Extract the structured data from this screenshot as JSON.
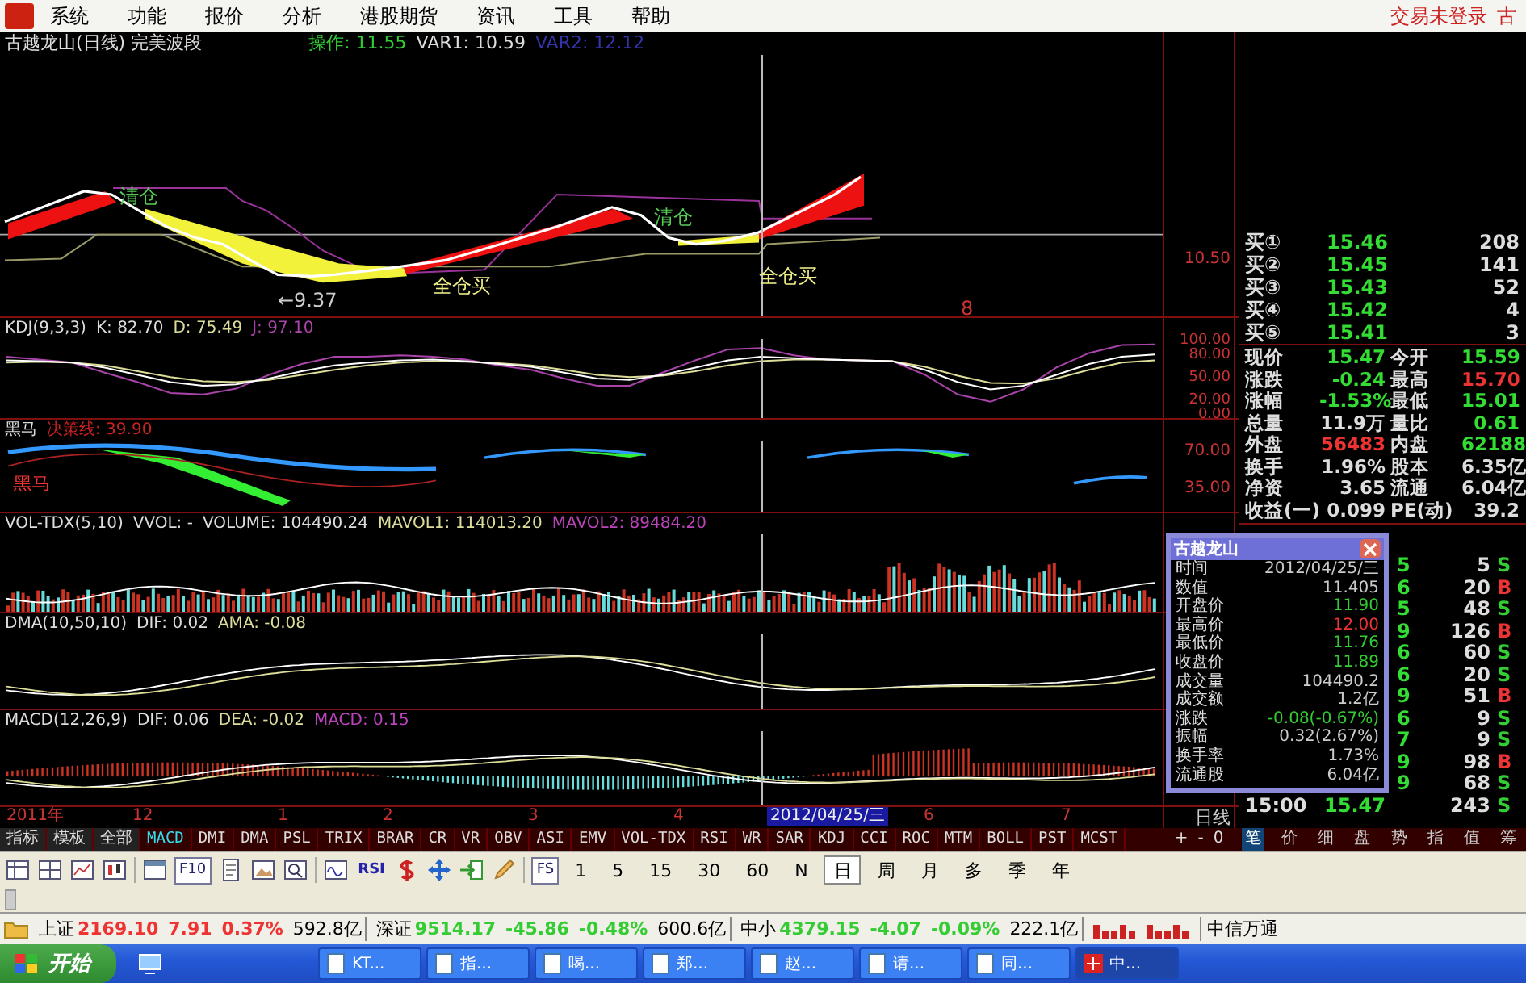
{
  "menu_bar": {
    "items": [
      "系统",
      "功能",
      "报价",
      "分析",
      "港股期货",
      "资讯",
      "工具",
      "帮助"
    ],
    "right_texts": [
      "交易未登录",
      "古"
    ]
  },
  "price_panel": {
    "title": "古越龙山(日线) 完美波段",
    "readouts": [
      {
        "text": "操作: 11.55",
        "color": "#33cc33"
      },
      {
        "text": "VAR1: 10.59",
        "color": "#dddddd"
      },
      {
        "text": "VAR2: 12.12",
        "color": "#3333aa"
      }
    ],
    "chart_labels": [
      {
        "text": "清仓",
        "kind": "sell"
      },
      {
        "text": "全仓买",
        "kind": "buy"
      },
      {
        "text": "清仓",
        "kind": "sell"
      },
      {
        "text": "全仓买",
        "kind": "buy"
      },
      {
        "text": "←9.37",
        "kind": "low"
      },
      {
        "text": "8",
        "kind": "marker"
      }
    ],
    "axis_labels": [
      "10.50"
    ]
  },
  "indicator_panels": [
    {
      "kind": "kdj",
      "readouts": [
        {
          "text": "KDJ(9,3,3)",
          "color": "#dddddd"
        },
        {
          "text": "K: 82.70",
          "color": "#dddddd"
        },
        {
          "text": "D: 75.49",
          "color": "#dddd99"
        },
        {
          "text": "J: 97.10",
          "color": "#aa44aa"
        }
      ],
      "chart_data": {
        "type": "line",
        "ylim": [
          0,
          100
        ],
        "yticks": [
          {
            "value": 100,
            "label": "100.00"
          },
          {
            "value": 80,
            "label": "80.00"
          },
          {
            "value": 50,
            "label": "50.00"
          },
          {
            "value": 20,
            "label": "20.00"
          },
          {
            "value": 0,
            "label": "0.00"
          }
        ],
        "series": [
          {
            "color": "#aa44aa",
            "values": [
              80,
              76,
              72,
              58,
              45,
              30,
              28,
              36,
              55,
              70,
              80,
              80,
              82,
              80,
              76,
              68,
              62,
              50,
              40,
              40,
              58,
              75,
              90,
              92,
              82,
              76,
              75,
              74,
              55,
              28,
              18,
              35,
              65,
              85,
              96,
              97
            ]
          },
          {
            "color": "#dddd99",
            "values": [
              72,
              73,
              72,
              68,
              60,
              52,
              46,
              45,
              48,
              55,
              62,
              68,
              72,
              74,
              73,
              71,
              68,
              62,
              55,
              52,
              54,
              60,
              68,
              74,
              76,
              76,
              75,
              74,
              66,
              54,
              44,
              43,
              50,
              62,
              72,
              75
            ]
          },
          {
            "color": "#ffffff",
            "values": [
              75,
              74,
              72,
              65,
              55,
              45,
              40,
              42,
              50,
              60,
              68,
              72,
              75,
              76,
              74,
              70,
              66,
              58,
              50,
              48,
              55,
              65,
              75,
              80,
              78,
              76,
              75,
              74,
              62,
              45,
              35,
              40,
              55,
              70,
              80,
              83
            ]
          }
        ]
      }
    },
    {
      "kind": "heima",
      "readouts": [
        {
          "text": "黑马",
          "color": "#dddddd"
        },
        {
          "text": "决策线: 39.90",
          "color": "#cc2222"
        }
      ],
      "chart_label": "黑马",
      "axis_labels": [
        "70.00",
        "35.00"
      ]
    },
    {
      "kind": "volume",
      "readouts": [
        {
          "text": "VOL-TDX(5,10)",
          "color": "#dddddd"
        },
        {
          "text": "VVOL: -",
          "color": "#dddddd"
        },
        {
          "text": "VOLUME: 104490.24",
          "color": "#dddddd"
        },
        {
          "text": "MAVOL1: 114013.20",
          "color": "#dddd99"
        },
        {
          "text": "MAVOL2: 89484.20",
          "color": "#bb44bb"
        }
      ]
    },
    {
      "kind": "dma",
      "readouts": [
        {
          "text": "DMA(10,50,10)",
          "color": "#dddddd"
        },
        {
          "text": "DIF: 0.02",
          "color": "#dddddd"
        },
        {
          "text": "AMA: -0.08",
          "color": "#dddd99"
        }
      ]
    },
    {
      "kind": "macd",
      "readouts": [
        {
          "text": "MACD(12,26,9)",
          "color": "#dddddd"
        },
        {
          "text": "DIF: 0.06",
          "color": "#dddddd"
        },
        {
          "text": "DEA: -0.02",
          "color": "#dddd99"
        },
        {
          "text": "MACD: 0.15",
          "color": "#bb44bb"
        }
      ]
    }
  ],
  "date_axis": {
    "labels": [
      {
        "text": "2011年",
        "selected": false
      },
      {
        "text": "12",
        "selected": false
      },
      {
        "text": "1",
        "selected": false
      },
      {
        "text": "2",
        "selected": false
      },
      {
        "text": "3",
        "selected": false
      },
      {
        "text": "4",
        "selected": false
      },
      {
        "text": "2012/04/25/三",
        "selected": true
      },
      {
        "text": "6",
        "selected": false
      },
      {
        "text": "7",
        "selected": false
      }
    ],
    "period_label": "日线"
  },
  "order_book": [
    {
      "label": "买①",
      "price": "15.46",
      "volume": "208"
    },
    {
      "label": "买②",
      "price": "15.45",
      "volume": "141"
    },
    {
      "label": "买③",
      "price": "15.43",
      "volume": "52"
    },
    {
      "label": "买④",
      "price": "15.42",
      "volume": "4"
    },
    {
      "label": "买⑤",
      "price": "15.41",
      "volume": "3"
    }
  ],
  "stats": [
    {
      "cells": [
        {
          "text": "现价"
        },
        {
          "text": "15.47",
          "color": "#33dd33"
        },
        {
          "text": "今开"
        },
        {
          "text": "15.59",
          "color": "#33dd33"
        }
      ]
    },
    {
      "cells": [
        {
          "text": "涨跌"
        },
        {
          "text": "-0.24",
          "color": "#33dd33"
        },
        {
          "text": "最高"
        },
        {
          "text": "15.70",
          "color": "#ee3333"
        }
      ]
    },
    {
      "cells": [
        {
          "text": "涨幅"
        },
        {
          "text": "-1.53%",
          "color": "#33dd33"
        },
        {
          "text": "最低"
        },
        {
          "text": "15.01",
          "color": "#33dd33"
        }
      ]
    },
    {
      "cells": [
        {
          "text": "总量"
        },
        {
          "text": "11.9万",
          "color": "#dddddd"
        },
        {
          "text": "量比"
        },
        {
          "text": "0.61",
          "color": "#33dd33"
        }
      ]
    },
    {
      "cells": [
        {
          "text": "外盘"
        },
        {
          "text": "56483",
          "color": "#ee3333"
        },
        {
          "text": "内盘"
        },
        {
          "text": "62188",
          "color": "#33dd33"
        }
      ]
    },
    {
      "cells": [
        {
          "text": "换手"
        },
        {
          "text": "1.96%",
          "color": "#dddddd"
        },
        {
          "text": "股本"
        },
        {
          "text": "6.35亿",
          "color": "#dddddd"
        }
      ]
    },
    {
      "cells": [
        {
          "text": "净资"
        },
        {
          "text": "3.65",
          "color": "#dddddd"
        },
        {
          "text": "流通"
        },
        {
          "text": "6.04亿",
          "color": "#dddddd"
        }
      ]
    },
    {
      "cells": [
        {
          "text": "收益(一)"
        },
        {
          "text": "0.099",
          "color": "#dddddd"
        },
        {
          "text": "PE(动)"
        },
        {
          "text": "39.2",
          "color": "#dddddd"
        }
      ]
    }
  ],
  "ticks": [
    {
      "price": "5",
      "volume": "5",
      "side": "S",
      "kind": "sell"
    },
    {
      "price": "6",
      "volume": "20",
      "side": "B",
      "kind": "buy"
    },
    {
      "price": "5",
      "volume": "48",
      "side": "S",
      "kind": "sell"
    },
    {
      "price": "9",
      "volume": "126",
      "side": "B",
      "kind": "buy"
    },
    {
      "price": "6",
      "volume": "60",
      "side": "S",
      "kind": "sell"
    },
    {
      "price": "6",
      "volume": "20",
      "side": "S",
      "kind": "sell"
    },
    {
      "price": "9",
      "volume": "51",
      "side": "B",
      "kind": "buy"
    },
    {
      "price": "6",
      "volume": "9",
      "side": "S",
      "kind": "sell"
    },
    {
      "price": "7",
      "volume": "9",
      "side": "S",
      "kind": "sell"
    },
    {
      "price": "9",
      "volume": "98",
      "side": "B",
      "kind": "buy"
    },
    {
      "price": "9",
      "volume": "68",
      "side": "S",
      "kind": "sell"
    },
    {
      "time": "15:00",
      "price": "15.47",
      "volume": "243",
      "side": "S",
      "kind": "sell"
    }
  ],
  "popup": {
    "title": "古越龙山",
    "rows": [
      {
        "label": "时间",
        "value": "2012/04/25/三"
      },
      {
        "label": "数值",
        "value": "11.405"
      },
      {
        "label": "开盘价",
        "value": "11.90",
        "color": "#33cc33"
      },
      {
        "label": "最高价",
        "value": "12.00",
        "color": "#ee3333"
      },
      {
        "label": "最低价",
        "value": "11.76",
        "color": "#33cc33"
      },
      {
        "label": "收盘价",
        "value": "11.89",
        "color": "#33cc33"
      },
      {
        "label": "成交量",
        "value": "104490.2"
      },
      {
        "label": "成交额",
        "value": "1.2亿"
      },
      {
        "label": "涨跌",
        "value": "-0.08(-0.67%)",
        "color": "#33cc33"
      },
      {
        "label": "振幅",
        "value": "0.32(2.67%)"
      },
      {
        "label": "换手率",
        "value": "1.73%"
      },
      {
        "label": "流通股",
        "value": "6.04亿"
      }
    ]
  },
  "indicator_tabs": [
    {
      "label": "指标",
      "selected": false
    },
    {
      "label": "模板",
      "selected": false
    },
    {
      "label": "全部",
      "selected": false
    },
    {
      "label": "MACD",
      "selected": true
    },
    {
      "label": "DMI",
      "selected": false
    },
    {
      "label": "DMA",
      "selected": false
    },
    {
      "label": "PSL",
      "selected": false
    },
    {
      "label": "TRIX",
      "selected": false
    },
    {
      "label": "BRAR",
      "selected": false
    },
    {
      "label": "CR",
      "selected": false
    },
    {
      "label": "VR",
      "selected": false
    },
    {
      "label": "OBV",
      "selected": false
    },
    {
      "label": "ASI",
      "selected": false
    },
    {
      "label": "EMV",
      "selected": false
    },
    {
      "label": "VOL-TDX",
      "selected": false
    },
    {
      "label": "RSI",
      "selected": false
    },
    {
      "label": "WR",
      "selected": false
    },
    {
      "label": "SAR",
      "selected": false
    },
    {
      "label": "KDJ",
      "selected": false
    },
    {
      "label": "CCI",
      "selected": false
    },
    {
      "label": "ROC",
      "selected": false
    },
    {
      "label": "MTM",
      "selected": false
    },
    {
      "label": "BOLL",
      "selected": false
    },
    {
      "label": "PST",
      "selected": false
    },
    {
      "label": "MCST",
      "selected": false
    }
  ],
  "zoom_controls": [
    "+",
    "-",
    "0"
  ],
  "detail_tabs": [
    {
      "label": "笔",
      "selected": true
    },
    {
      "label": "价",
      "selected": false
    },
    {
      "label": "细",
      "selected": false
    },
    {
      "label": "盘",
      "selected": false
    },
    {
      "label": "势",
      "selected": false
    },
    {
      "label": "指",
      "selected": false
    },
    {
      "label": "值",
      "selected": false
    },
    {
      "label": "筹",
      "selected": false
    }
  ],
  "toolbar": {
    "text_buttons": [
      "F10",
      "RSI",
      "FS"
    ],
    "periods": [
      {
        "label": "1",
        "selected": false
      },
      {
        "label": "5",
        "selected": false
      },
      {
        "label": "15",
        "selected": false
      },
      {
        "label": "30",
        "selected": false
      },
      {
        "label": "60",
        "selected": false
      },
      {
        "label": "N",
        "selected": false
      },
      {
        "label": "日",
        "selected": true
      },
      {
        "label": "周",
        "selected": false
      },
      {
        "label": "月",
        "selected": false
      },
      {
        "label": "多",
        "selected": false
      },
      {
        "label": "季",
        "selected": false
      },
      {
        "label": "年",
        "selected": false
      }
    ]
  },
  "status_bar": {
    "indices": [
      {
        "name": "上证",
        "value": "2169.10",
        "change": "7.91",
        "percent": "0.37%",
        "amount": "592.8亿",
        "kind": "up"
      },
      {
        "name": "深证",
        "value": "9514.17",
        "change": "-45.86",
        "percent": "-0.48%",
        "amount": "600.6亿",
        "kind": "down"
      },
      {
        "name": "中小",
        "value": "4379.15",
        "change": "-4.07",
        "percent": "-0.09%",
        "amount": "222.1亿",
        "kind": "down"
      }
    ],
    "broker": "中信万通"
  },
  "taskbar": {
    "start": "开始",
    "tasks": [
      {
        "label": "KT...",
        "selected": false
      },
      {
        "label": "指...",
        "selected": false
      },
      {
        "label": "喝...",
        "selected": false
      },
      {
        "label": "郑...",
        "selected": false
      },
      {
        "label": "赵...",
        "selected": false
      },
      {
        "label": "请...",
        "selected": false
      },
      {
        "label": "同...",
        "selected": false
      },
      {
        "label": "中...",
        "selected": true
      }
    ]
  }
}
